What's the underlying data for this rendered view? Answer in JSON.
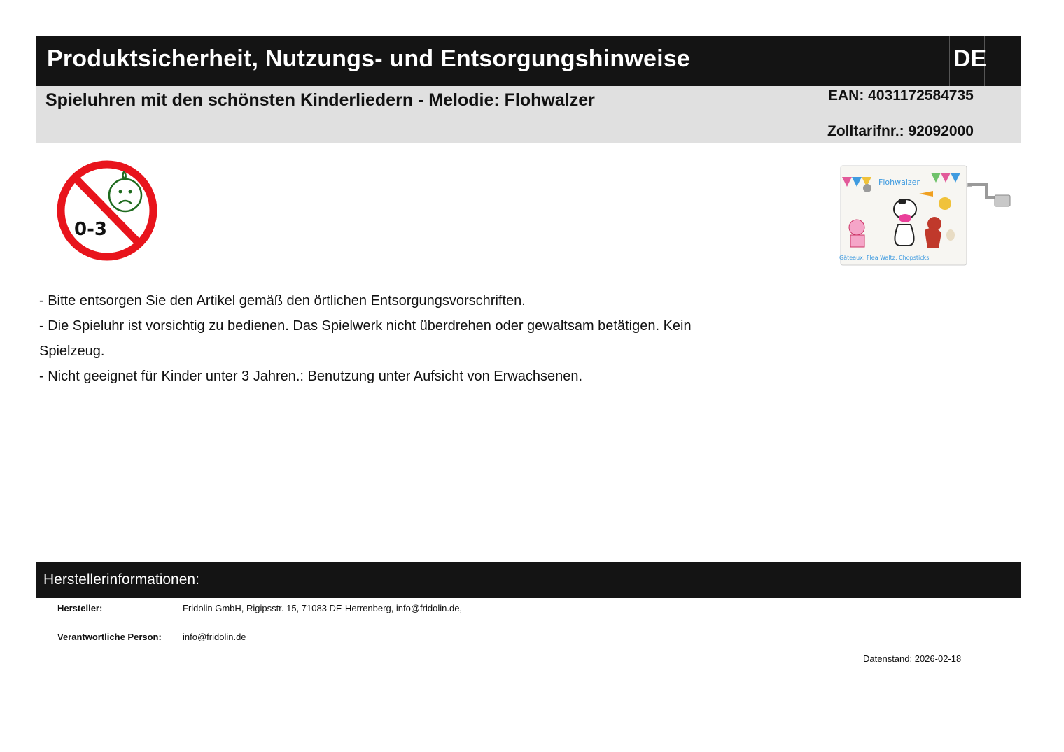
{
  "header": {
    "title": "Produktsicherheit, Nutzungs- und Entsorgungshinweise",
    "language": "DE"
  },
  "product": {
    "name": "Spieluhren mit den schönsten Kinderliedern - Melodie: Flohwalzer",
    "ean": "EAN: 4031172584735",
    "customs": "Zolltarifnr.: 92092000"
  },
  "warning_icon": {
    "age_label": "0-3",
    "icon": "not-for-children-under-3-icon"
  },
  "product_image": {
    "box_title": "Flohwalzer",
    "box_footer": "Gâteaux, Flea Waltz, Chopsticks"
  },
  "notes": [
    "- Bitte entsorgen Sie den Artikel gemäß den örtlichen Entsorgungsvorschriften.",
    "- Die Spieluhr ist vorsichtig zu bedienen. Das Spielwerk nicht überdrehen oder gewaltsam betätigen. Kein Spielzeug.",
    "- Nicht geeignet für Kinder unter 3 Jahren.: Benutzung unter Aufsicht von Erwachsenen."
  ],
  "manufacturer": {
    "section_label": "Herstellerinformationen:",
    "hersteller_key": "Hersteller:",
    "hersteller_value": "Fridolin GmbH, Rigipsstr. 15, 71083 DE-Herrenberg, info@fridolin.de,",
    "person_key": "Verantwortliche Person:",
    "person_value": "info@fridolin.de"
  },
  "date": "Datenstand: 2026-02-18",
  "colors": {
    "header_bg": "#141414",
    "subheader_bg": "#e0e0e0",
    "warning_red": "#e8141c",
    "face_green": "#1f6b1f"
  }
}
